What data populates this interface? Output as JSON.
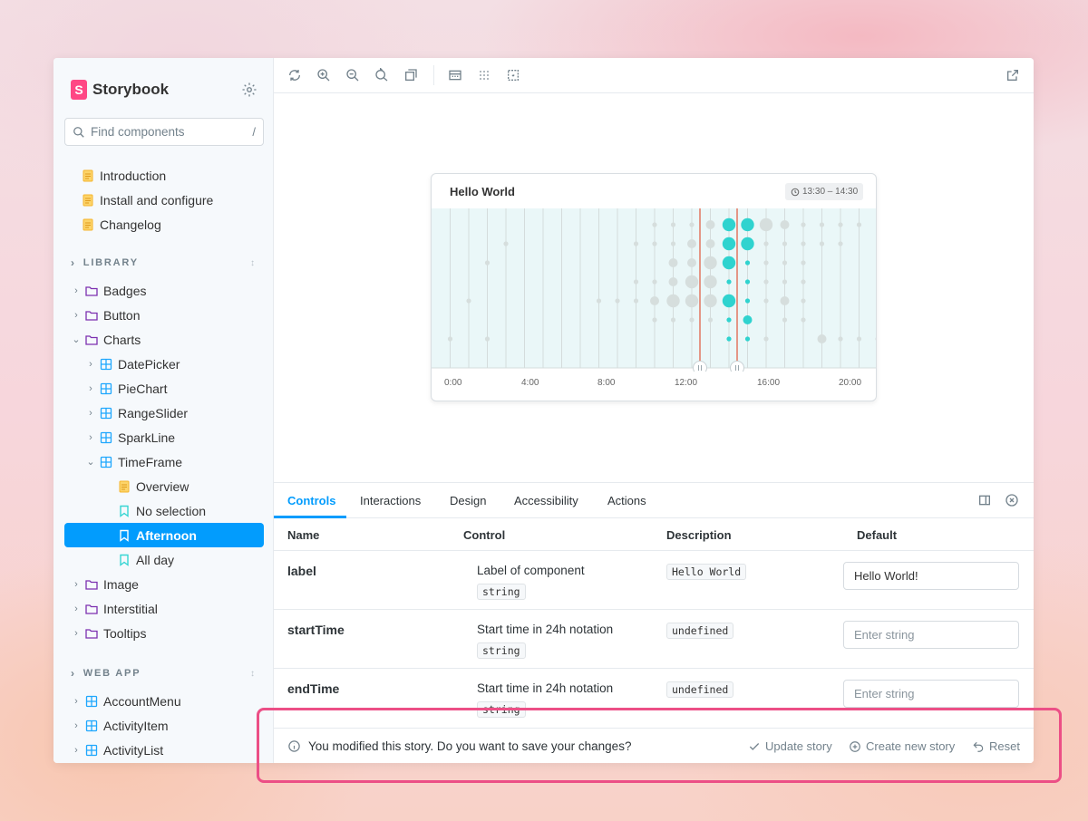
{
  "brand": {
    "name": "Storybook",
    "logo_letter": "S",
    "accent": "#ff4785"
  },
  "search": {
    "placeholder": "Find components",
    "shortcut": "/"
  },
  "sidebar": {
    "docs": [
      "Introduction",
      "Install and configure",
      "Changelog"
    ],
    "library_label": "LIBRARY",
    "library": [
      {
        "label": "Badges",
        "type": "folder"
      },
      {
        "label": "Button",
        "type": "folder"
      },
      {
        "label": "Charts",
        "type": "folder"
      },
      {
        "label": "DatePicker",
        "type": "component"
      },
      {
        "label": "PieChart",
        "type": "component"
      },
      {
        "label": "RangeSlider",
        "type": "component"
      },
      {
        "label": "SparkLine",
        "type": "component"
      },
      {
        "label": "TimeFrame",
        "type": "component"
      },
      {
        "label": "Overview",
        "type": "doc"
      },
      {
        "label": "No selection",
        "type": "story"
      },
      {
        "label": "Afternoon",
        "type": "story",
        "selected": true
      },
      {
        "label": "All day",
        "type": "story"
      },
      {
        "label": "Image",
        "type": "folder"
      },
      {
        "label": "Interstitial",
        "type": "folder"
      },
      {
        "label": "Tooltips",
        "type": "folder"
      }
    ],
    "webapp_label": "WEB APP",
    "webapp": [
      "AccountMenu",
      "ActivityItem",
      "ActivityList"
    ]
  },
  "preview": {
    "title": "Hello World",
    "time_range": "13:30 – 14:30",
    "ticks": [
      "0:00",
      "4:00",
      "8:00",
      "12:00",
      "16:00",
      "20:00"
    ]
  },
  "panel": {
    "tabs": [
      "Controls",
      "Interactions",
      "Design",
      "Accessibility",
      "Actions"
    ],
    "columns": [
      "Name",
      "Control",
      "Description",
      "Default"
    ],
    "rows": [
      {
        "name": "label",
        "description": "Label of component",
        "type": "string",
        "default": "Hello World",
        "value": "Hello World!",
        "placeholder": ""
      },
      {
        "name": "startTime",
        "description": "Start time in 24h notation",
        "type": "string",
        "default": "undefined",
        "value": "",
        "placeholder": "Enter string"
      },
      {
        "name": "endTime",
        "description": "Start time in 24h notation",
        "type": "string",
        "default": "undefined",
        "value": "",
        "placeholder": "Enter string"
      }
    ]
  },
  "savebar": {
    "message": "You modified this story. Do you want to save your changes?",
    "update": "Update story",
    "create": "Create new story",
    "reset": "Reset"
  },
  "colors": {
    "selection": "#029cfd",
    "chart_active": "#2fd3cf",
    "chart_inactive": "#d6dedd",
    "range_line": "#e0573b",
    "highlight": "#ec4f86"
  }
}
